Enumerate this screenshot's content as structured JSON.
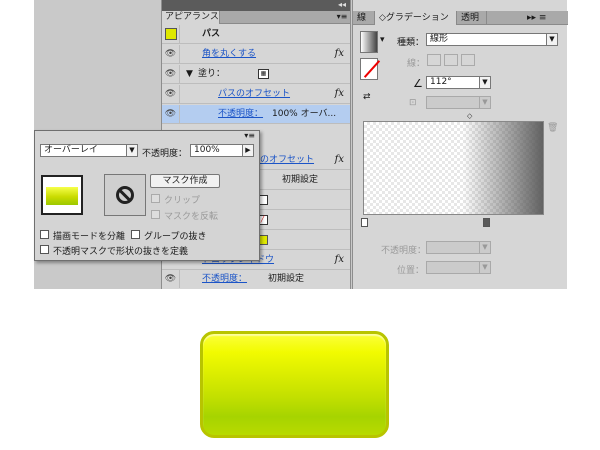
{
  "appearance": {
    "tab": "アピアランス",
    "object": "パス",
    "rows": {
      "round_corners": "角を丸くする",
      "fill": "塗り：",
      "offset_path": "パスのオフセット",
      "opacity1_label": "不透明度：",
      "opacity1_value": "100% オーバ...",
      "offset_path2": "パスのオフセット",
      "default_setting": "初期設定",
      "drop_shadow": "ドロップシャドウ",
      "opacity2_label": "不透明度：",
      "opacity2_value": "初期設定"
    },
    "fx": "fx"
  },
  "gradient_panel": {
    "tabs": [
      "線",
      "◇グラデーション",
      "透明"
    ],
    "type_label": "種類：",
    "type_value": "線形",
    "stroke_label": "線：",
    "angle_value": "112°",
    "opacity_label": "不透明度：",
    "position_label": "位置："
  },
  "transparency_popover": {
    "blend_mode": "オーバーレイ",
    "opacity_label": "不透明度：",
    "opacity_value": "100%",
    "make_mask_button": "マスク作成",
    "clip_label": "クリップ",
    "invert_mask_label": "マスクを反転",
    "isolate_blending_label": "描画モードを分離",
    "knockout_group_label": "グループの抜き",
    "opacity_mask_label": "不透明マスクで形状の抜きを定義"
  },
  "colors": {
    "panel_bg": "#d6d6d6",
    "link_blue": "#1b54c7",
    "highlight_row": "#b4cdf0",
    "gradient_start": "#fbff3a",
    "gradient_end": "#a6d400"
  }
}
